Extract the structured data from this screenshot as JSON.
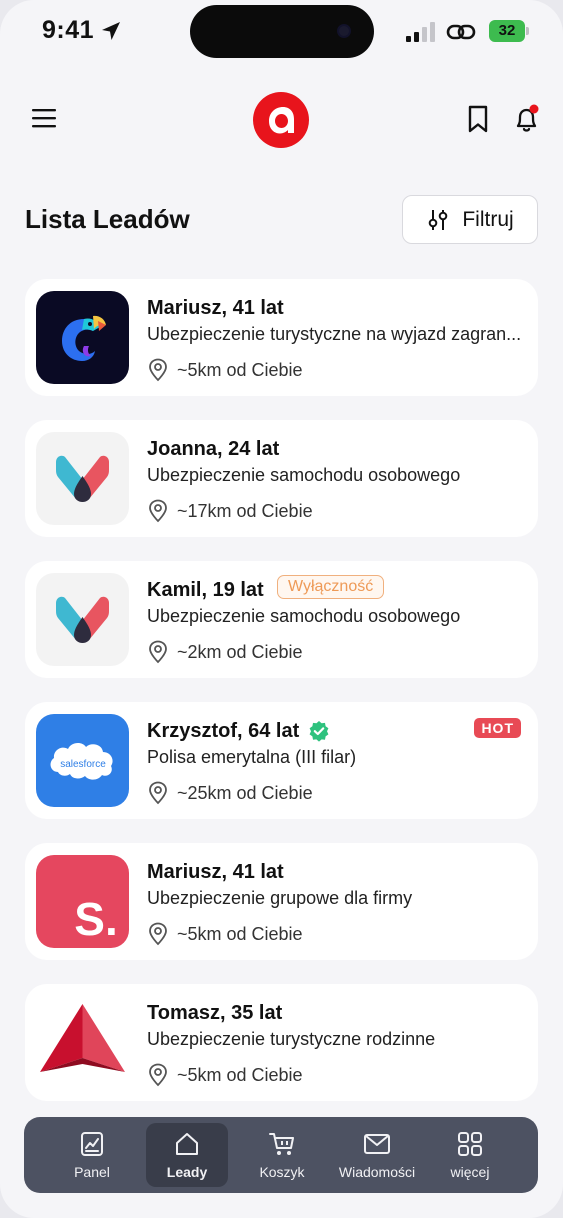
{
  "status_bar": {
    "time": "9:41",
    "battery": "32"
  },
  "header": {
    "menu_icon": "hamburger-icon",
    "logo_icon": "app-logo",
    "bookmark_icon": "bookmark-icon",
    "notifications_icon": "bell-icon"
  },
  "page": {
    "title": "Lista Leadów",
    "filter_label": "Filtruj",
    "filter_icon": "sliders-icon"
  },
  "leads": [
    {
      "name": "Mariusz, 41 lat",
      "description": "Ubezpieczenie turystyczne na wyjazd zagran...",
      "distance": "~5km od Ciebie",
      "logo": "chameleon-logo"
    },
    {
      "name": "Joanna, 24 lat",
      "description": "Ubezpieczenie samochodu osobowego",
      "distance": "~17km od Ciebie",
      "logo": "m-logo"
    },
    {
      "name": "Kamil, 19 lat",
      "badge": "Wyłączność",
      "description": "Ubezpieczenie samochodu osobowego",
      "distance": "~2km od Ciebie",
      "logo": "m-logo"
    },
    {
      "name": "Krzysztof, 64 lat",
      "verified": true,
      "hot": "HOT",
      "description": "Polisa emerytalna (III filar)",
      "distance": "~25km od Ciebie",
      "logo": "salesforce-logo",
      "logo_text": "salesforce"
    },
    {
      "name": "Mariusz, 41 lat",
      "description": "Ubezpieczenie grupowe dla firmy",
      "distance": "~5km od Ciebie",
      "logo": "s-logo",
      "logo_text": "S."
    },
    {
      "name": "Tomasz, 35 lat",
      "description": "Ubezpieczenie turystyczne rodzinne",
      "distance": "~5km od Ciebie",
      "logo": "delta-logo"
    }
  ],
  "bottom_nav": [
    {
      "label": "Panel",
      "icon": "chart-icon",
      "active": false
    },
    {
      "label": "Leady",
      "icon": "home-icon",
      "active": true
    },
    {
      "label": "Koszyk",
      "icon": "cart-icon",
      "active": false
    },
    {
      "label": "Wiadomości",
      "icon": "mail-icon",
      "active": false
    },
    {
      "label": "więcej",
      "icon": "grid-icon",
      "active": false
    }
  ],
  "colors": {
    "brand_red": "#e8141c",
    "nav_bg": "#4d5262",
    "hot_badge": "#e84a55",
    "exclusive_badge": "#ee9a57",
    "verified": "#2ec27e"
  }
}
